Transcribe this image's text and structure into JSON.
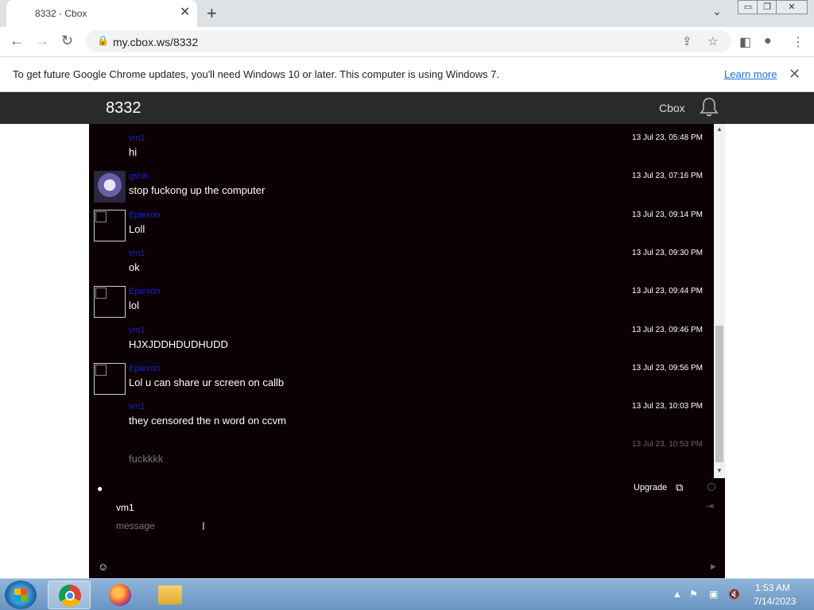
{
  "browser": {
    "tab_title": "8332 · Cbox",
    "tab_close": "✕",
    "new_tab": "+",
    "tab_list": "⌄",
    "url": "my.cbox.ws/8332",
    "window_buttons": {
      "minimize": "▭",
      "restore": "❐",
      "close": "✕"
    }
  },
  "infobar": {
    "message": "To get future Google Chrome updates, you'll need Windows 10 or later. This computer is using Windows 7.",
    "link": "Learn more",
    "close": "✕"
  },
  "header": {
    "title": "8332",
    "cbox_link": "Cbox"
  },
  "messages": [
    {
      "name": "vm1",
      "text": "hi",
      "time": "13 Jul 23, 05:48 PM",
      "avatar": "none"
    },
    {
      "name": "gshh",
      "text": "stop fuckong up the computer",
      "time": "13 Jul 23, 07:16 PM",
      "avatar": "picture"
    },
    {
      "name": "Epiexon",
      "text": "Loll",
      "time": "13 Jul 23, 09:14 PM",
      "avatar": "broken"
    },
    {
      "name": "vm1",
      "text": "ok",
      "time": "13 Jul 23, 09:30 PM",
      "avatar": "none"
    },
    {
      "name": "Epiexon",
      "text": "lol",
      "time": "13 Jul 23, 09:44 PM",
      "avatar": "broken"
    },
    {
      "name": "vm1",
      "text": "HJXJDDHDUDHUDD",
      "time": "13 Jul 23, 09:46 PM",
      "avatar": "none"
    },
    {
      "name": "Epiexon",
      "text": "Lol u can share ur screen on callb",
      "time": "13 Jul 23, 09:56 PM",
      "avatar": "broken"
    },
    {
      "name": "vm1",
      "text": "they censored the n word on ccvm",
      "time": "13 Jul 23, 10:03 PM",
      "avatar": "none"
    },
    {
      "name": "",
      "text": "fuckkkk",
      "time": "13 Jul 23, 10:53 PM",
      "avatar": "none",
      "pending": true
    }
  ],
  "input": {
    "name_value": "vm1",
    "message_placeholder": "message",
    "upgrade": "Upgrade"
  },
  "taskbar": {
    "time": "1:53 AM",
    "date": "7/14/2023"
  },
  "colors": {
    "chat_bg": "#0b0004",
    "username": "#1822c8",
    "header_bg": "#2a2a2a"
  }
}
